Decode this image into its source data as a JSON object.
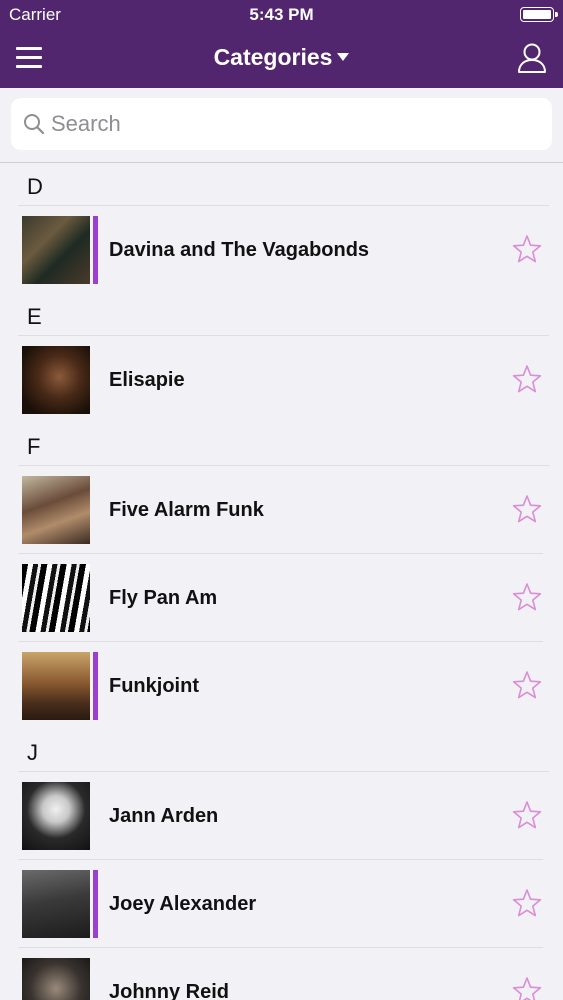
{
  "status_bar": {
    "carrier": "Carrier",
    "time": "5:43 PM"
  },
  "nav": {
    "title": "Categories",
    "menu_icon": "hamburger-menu-icon",
    "profile_icon": "user-profile-icon"
  },
  "search": {
    "placeholder": "Search",
    "value": ""
  },
  "colors": {
    "nav_bg": "#52266f",
    "accent": "#9b3fd1",
    "star": "#d98ed6"
  },
  "sections": [
    {
      "letter": "D",
      "items": [
        {
          "name": "Davina and The Vagabonds",
          "highlighted": true
        }
      ]
    },
    {
      "letter": "E",
      "items": [
        {
          "name": "Elisapie",
          "highlighted": false
        }
      ]
    },
    {
      "letter": "F",
      "items": [
        {
          "name": "Five Alarm Funk",
          "highlighted": false
        },
        {
          "name": "Fly Pan Am",
          "highlighted": false
        },
        {
          "name": "Funkjoint",
          "highlighted": true
        }
      ]
    },
    {
      "letter": "J",
      "items": [
        {
          "name": "Jann Arden",
          "highlighted": false
        },
        {
          "name": "Joey Alexander",
          "highlighted": true
        },
        {
          "name": "Johnny Reid",
          "highlighted": false
        }
      ]
    }
  ]
}
